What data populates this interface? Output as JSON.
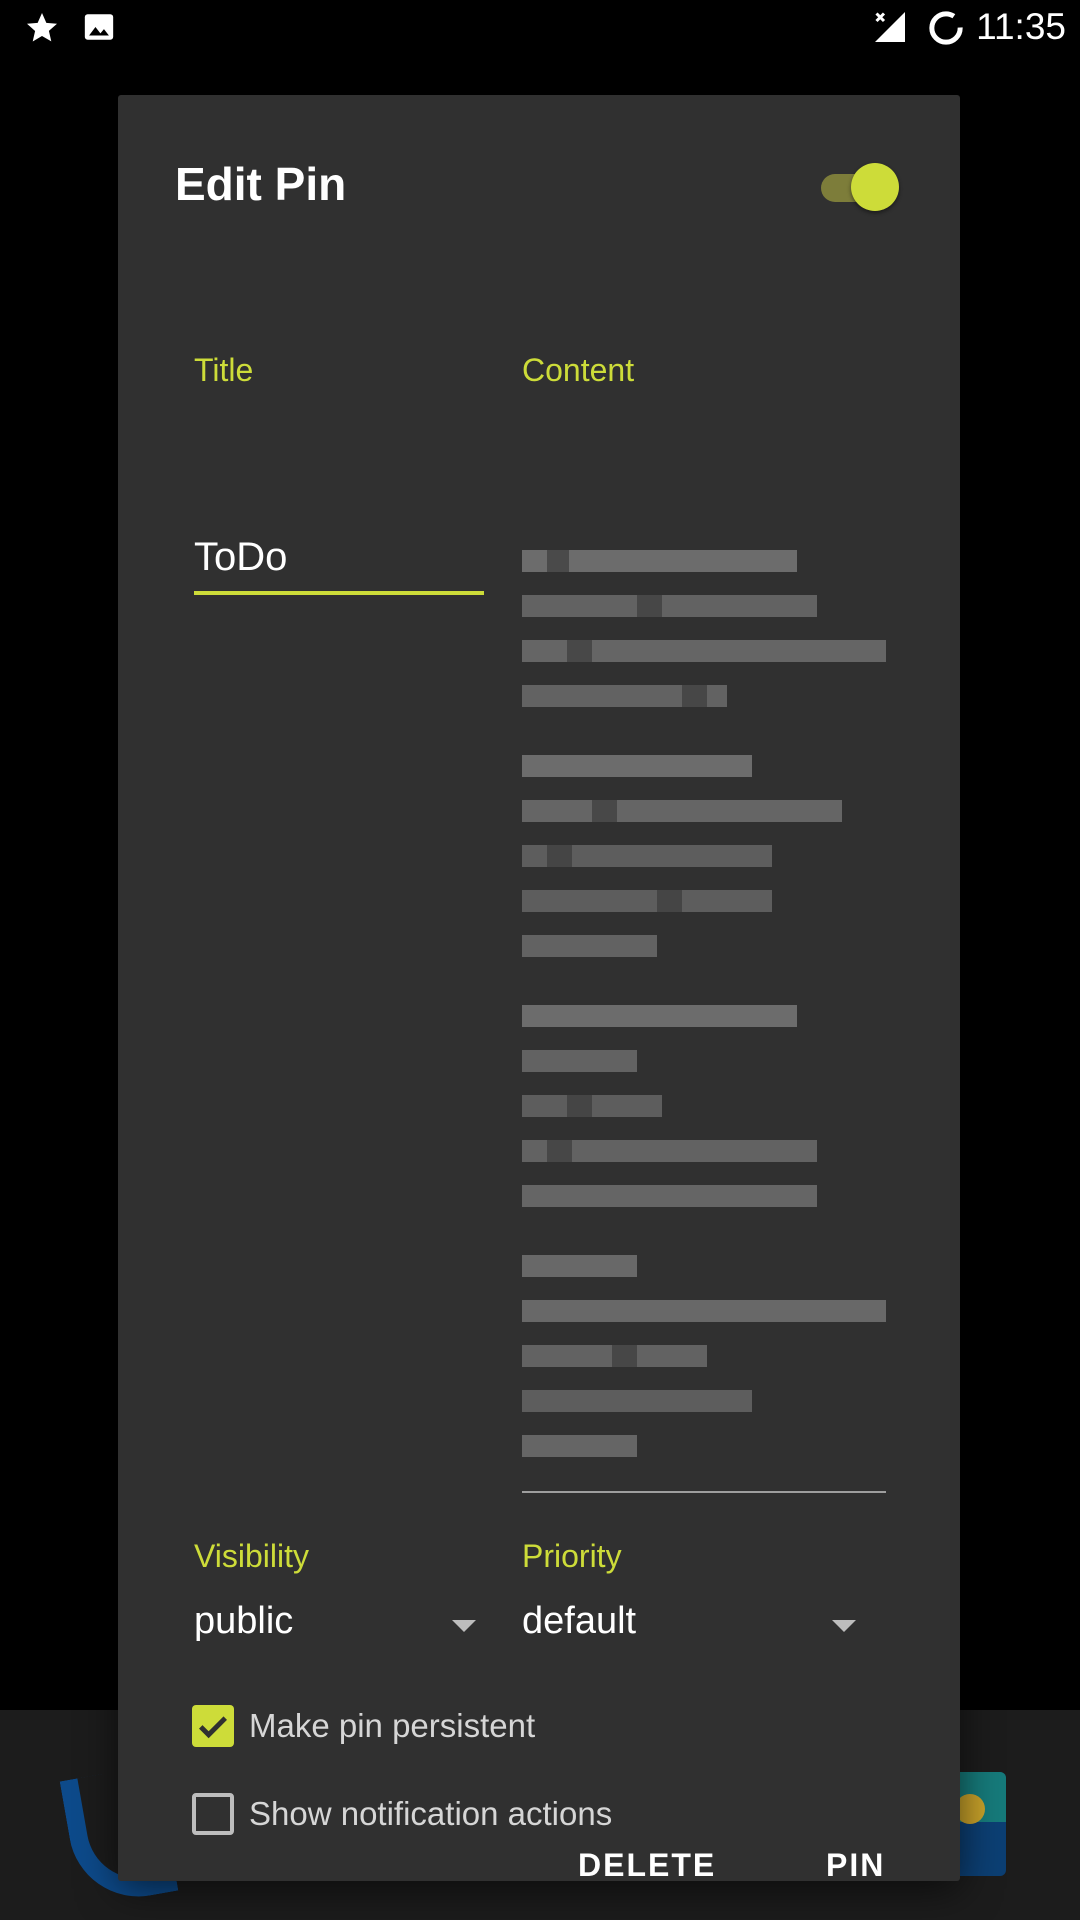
{
  "status_bar": {
    "time": "11:35",
    "left_icons": [
      "star-icon",
      "image-icon"
    ],
    "right_icons": [
      "signal-no-service-icon",
      "battery-charging-icon"
    ]
  },
  "dialog": {
    "title": "Edit Pin",
    "enabled_toggle": true,
    "title_label": "Title",
    "title_value": "ToDo",
    "content_label": "Content",
    "content_value": "(content obscured)",
    "visibility_label": "Visibility",
    "visibility_value": "public",
    "priority_label": "Priority",
    "priority_value": "default",
    "persistent_label": "Make pin persistent",
    "persistent_checked": true,
    "actions_label": "Show notification actions",
    "actions_checked": false,
    "buttons": {
      "delete": "DELETE",
      "pin": "PIN"
    }
  },
  "colors": {
    "accent": "#cddc39",
    "dialog_bg": "#303030",
    "background": "#000000"
  }
}
